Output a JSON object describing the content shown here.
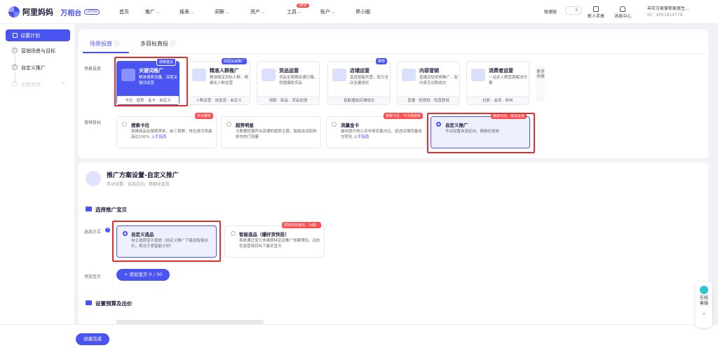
{
  "header": {
    "brand": "阿里妈妈",
    "product": "万相台",
    "version": "ULTRA",
    "nav": [
      {
        "label": "首页",
        "caret": false
      },
      {
        "label": "推广",
        "caret": true
      },
      {
        "label": "报表",
        "caret": true
      },
      {
        "label": "洞察",
        "caret": true
      },
      {
        "label": "资产",
        "caret": true
      },
      {
        "label": "工具",
        "caret": true,
        "badge": "NEW"
      },
      {
        "label": "账户",
        "caret": true
      },
      {
        "label": "界小圈",
        "caret": false
      }
    ],
    "mode_label": "极速版",
    "mode_toggle": "关",
    "help_label": "新人手册",
    "msg_label": "消息中心",
    "account_name": "丰实万家掌柜家居生...",
    "account_id": "ID：4651814778"
  },
  "sidebar": {
    "active": "设置计划",
    "steps": [
      {
        "num": "1",
        "label": "营销场景与目标"
      },
      {
        "num": "2",
        "label": "自定义推广"
      },
      {
        "num": "3",
        "label": "创建完成"
      }
    ]
  },
  "tabs": [
    {
      "label": "场景投放",
      "info": "ⓘ"
    },
    {
      "label": "多目标直投",
      "info": "ⓘ"
    }
  ],
  "scene_label": "场景投放",
  "scenes": [
    {
      "title": "关键词推广",
      "desc": "精准搜索流量、深度关键词运营",
      "footer": "卡位 · 趋势 · 金卡 · 自定义",
      "tag": "搜索建议"
    },
    {
      "title": "精准人群推广",
      "desc": "精准锁定目标人群，精细化人群运营",
      "footer": "人群运营 · 信息流 · 自定义",
      "tag": "拼团加速推广"
    },
    {
      "title": "货品运营",
      "desc": "货品全周期加速打爆，挖掘爆款货品",
      "footer": "测款 · 新品 · 货品加速",
      "tag": ""
    },
    {
      "title": "店铺运营",
      "desc": "直连智能托管，助力全店全量增长",
      "footer": "智能播放店铺成交",
      "tag": "推荐"
    },
    {
      "title": "内容营销",
      "desc": "直播及短视频推广，促内容互动和成交",
      "footer": "直播 · 短视频 · 短直联投",
      "tag": ""
    },
    {
      "title": "消费者运营",
      "desc": "一站式人群营销解决方案",
      "footer": "拉新 · 会员 · 粉丝",
      "tag": ""
    }
  ],
  "more_scenes": "更多场景",
  "goal_label": "营销目标",
  "goals": [
    {
      "title": "搜索卡位",
      "desc": "助推商品在搜索首条、前三首屏、抢位成功率最高达100%",
      "link": "上手指南",
      "tag": "热点推荐"
    },
    {
      "title": "趋势明星",
      "desc": "大数据挖掘符合店铺的趋势主题、智能选词助你抢夺热门流量",
      "link": "",
      "tag": ""
    },
    {
      "title": "流量金卡",
      "desc": "最向提升核心词市场流量占比，促进店铺流量成交转化",
      "link": "上手指南",
      "tag": "搜索卡位，可当热搜新"
    },
    {
      "title": "自定义推广",
      "desc": "手动设置自选定向、精细化投放",
      "link": "",
      "tag": "精准可控、按需投放"
    }
  ],
  "plan_section": {
    "title": "推广方案设置-自定义推广",
    "subtitle": "手动设置、自选定向、精细化投放"
  },
  "select_section": {
    "title": "选择推广宝贝",
    "method_label": "选品方式",
    "options": [
      {
        "title": "自定义选品",
        "desc": "自主选择宝贝投放（自定义推广下最加智能出价，相当于原智能计划）",
        "tag": ""
      },
      {
        "title": "智能选品（爆好货快投）",
        "desc": "系统通过宝贝多维度特征及推广效果预估，动态优选营销目标下最优宝贝",
        "tag": "帮助你快速找，为爆！"
      }
    ],
    "add_label": "添加宝贝",
    "add_button": "+ 添加宝贝 0 / 30"
  },
  "budget_section": {
    "title": "设置预算及出价"
  },
  "footer": {
    "create_button": "创建完成"
  },
  "float_service": {
    "label": "在线客服"
  }
}
